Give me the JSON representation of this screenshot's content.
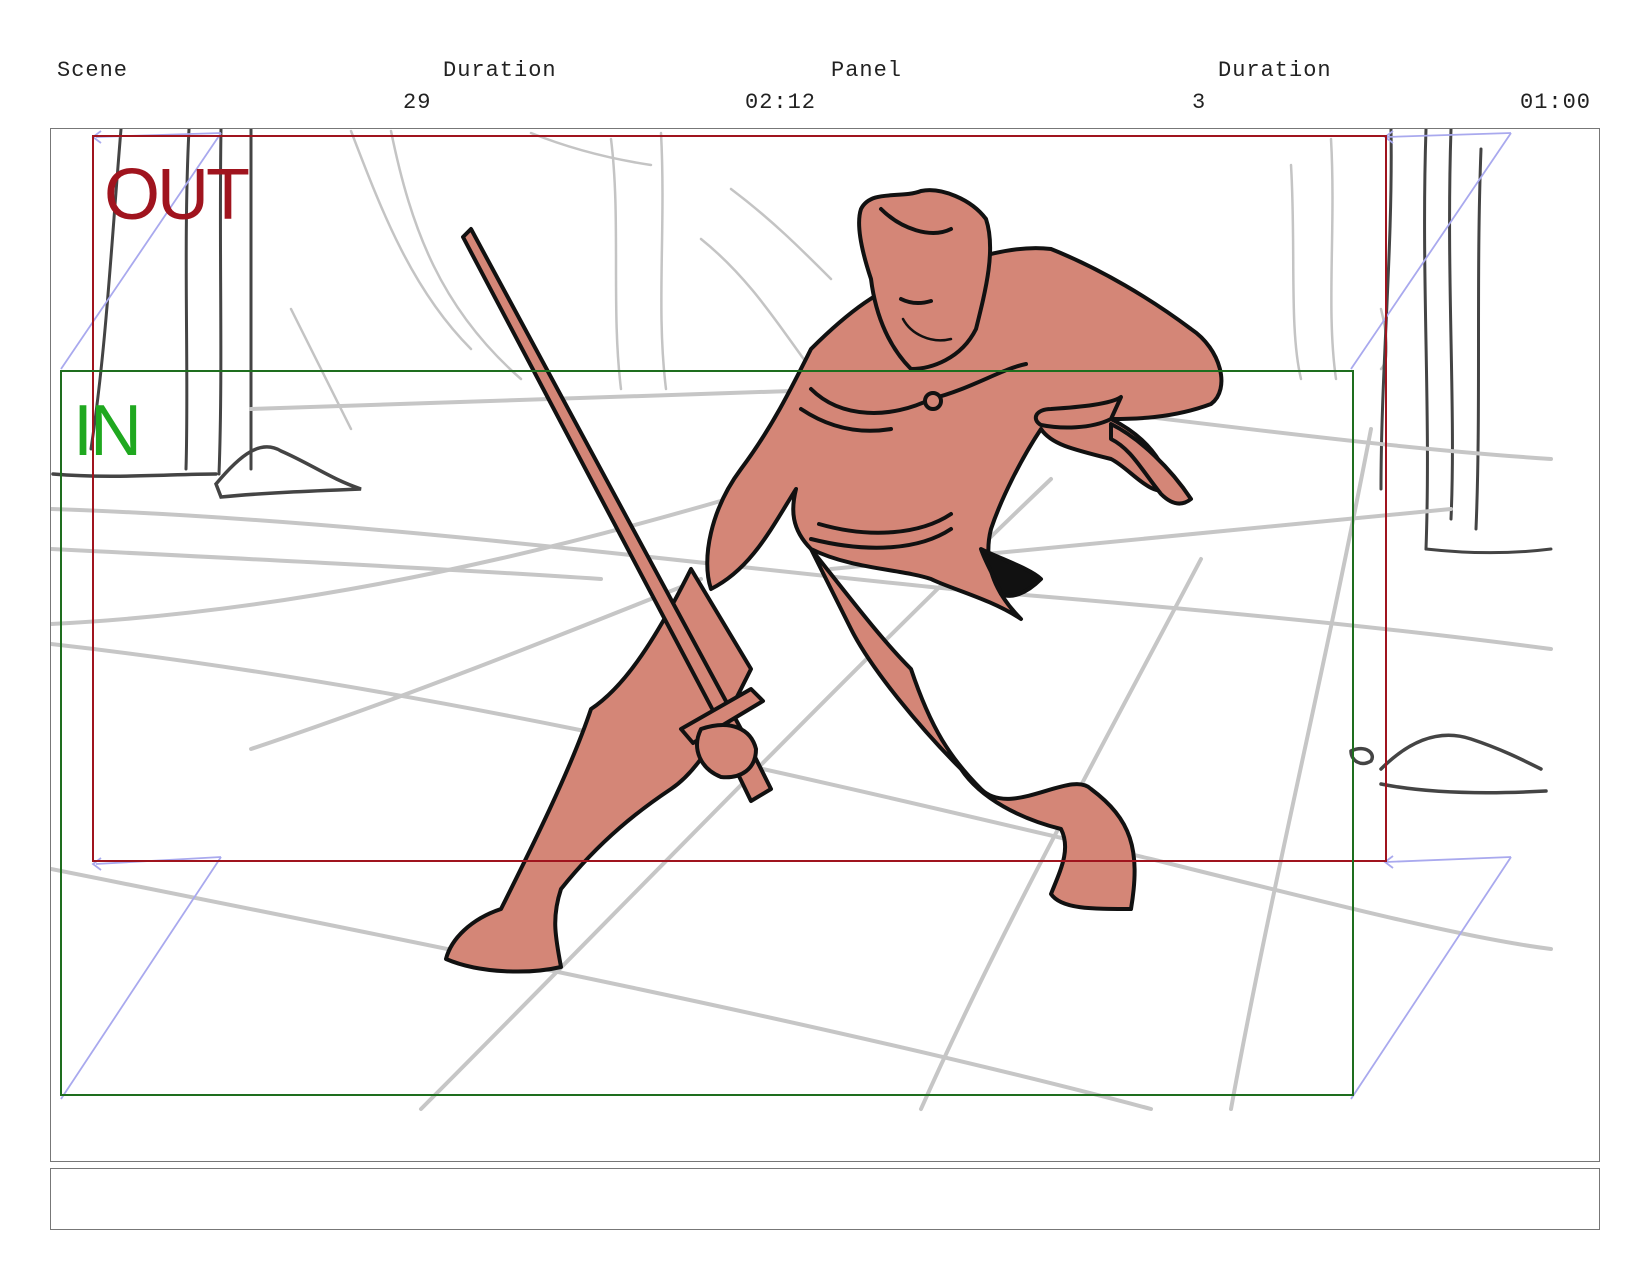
{
  "header": {
    "scene_label": "Scene",
    "scene_value": "29",
    "scene_duration_label": "Duration",
    "scene_duration_value": "02:12",
    "panel_label": "Panel",
    "panel_value": "3",
    "panel_duration_label": "Duration",
    "panel_duration_value": "01:00"
  },
  "panel": {
    "out_label": "OUT",
    "in_label": "IN",
    "colors": {
      "out_frame": "#a0141e",
      "in_frame": "#1e6e1e",
      "in_text": "#1fa81f",
      "character_fill": "#d48677",
      "ink": "#111111",
      "background_lines": "#c4c4c4",
      "camera_guides": "#a9a9ee"
    }
  },
  "notes": {
    "text": ""
  }
}
